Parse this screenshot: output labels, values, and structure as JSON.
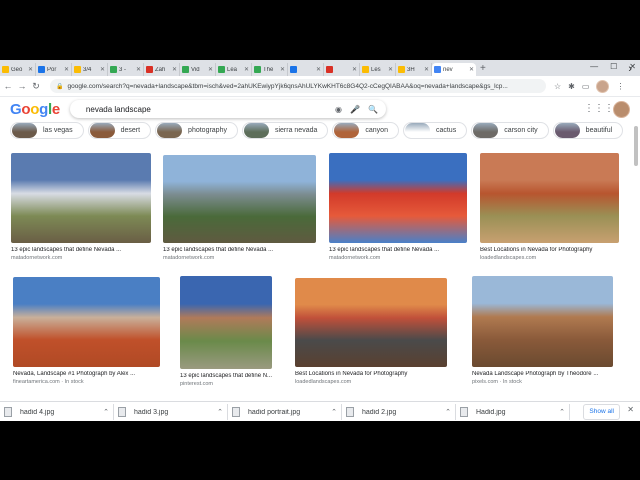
{
  "tabs": [
    {
      "label": "Geo",
      "color": "#fbbc04"
    },
    {
      "label": "Por",
      "color": "#1a73e8"
    },
    {
      "label": "3/4",
      "color": "#fbbc04"
    },
    {
      "label": "3 -",
      "color": "#34a853"
    },
    {
      "label": "Zah",
      "color": "#d93025"
    },
    {
      "label": "Vid",
      "color": "#34a853"
    },
    {
      "label": "Lea",
      "color": "#34a853"
    },
    {
      "label": "The",
      "color": "#34a853"
    },
    {
      "label": "",
      "color": "#1a73e8"
    },
    {
      "label": "",
      "color": "#d93025"
    },
    {
      "label": "Les",
      "color": "#fbbc04"
    },
    {
      "label": "3H",
      "color": "#fbbc04"
    }
  ],
  "active_tab": {
    "label": "nev",
    "color": "#4285f4"
  },
  "address": "google.com/search?q=nevada+landscape&tbm=isch&ved=2ahUKEwiypYjk6qnsAhULYKwKHT6c8G4Q2-cCegQIABAA&oq=nevada+landscape&gs_lcp...",
  "search": {
    "query": "nevada landscape"
  },
  "logo": "Google",
  "chips": [
    {
      "label": "las vegas",
      "color": "#6b5a4a"
    },
    {
      "label": "desert",
      "color": "#8a5a3a"
    },
    {
      "label": "photography",
      "color": "#7a6650"
    },
    {
      "label": "sierra nevada",
      "color": "#5d6e5a"
    },
    {
      "label": "canyon",
      "color": "#b0643a"
    },
    {
      "label": "cactus",
      "color": "#ffffff"
    },
    {
      "label": "carson city",
      "color": "#6d6a66"
    },
    {
      "label": "beautiful",
      "color": "#6a5a6e"
    }
  ],
  "results": [
    {
      "caption": "13 epic landscapes that define Nevada ...",
      "source": "matadornetwork.com",
      "colors": [
        "#5a7bb0",
        "#d8dce4",
        "#7d8a55",
        "#6a5e45"
      ]
    },
    {
      "caption": "13 epic landscapes that define Nevada ...",
      "source": "matadornetwork.com",
      "colors": [
        "#8fb3d9",
        "#7b8c8f",
        "#4a6a3a",
        "#5f5a40"
      ]
    },
    {
      "caption": "13 epic landscapes that define Nevada ...",
      "source": "matadornetwork.com",
      "colors": [
        "#3a6fc0",
        "#d23a2a",
        "#e65a3a",
        "#4a80c8"
      ]
    },
    {
      "caption": "Best Locations in Nevada for Photography",
      "source": "loadedlandscapes.com",
      "colors": [
        "#c97a55",
        "#b8552f",
        "#9a9055",
        "#c8a070"
      ]
    },
    {
      "caption": "Nevada, Landscape #1 Photograph by Alex ...",
      "source": "fineartamerica.com · In stock",
      "colors": [
        "#4a7fc4",
        "#c9b09a",
        "#c0502a",
        "#b04a25"
      ]
    },
    {
      "caption": "13 epic landscapes that define N...",
      "source": "pinterest.com",
      "colors": [
        "#3a66b0",
        "#b07a5a",
        "#6a8a4a",
        "#9a9a80"
      ]
    },
    {
      "caption": "Best Locations in Nevada for Photography",
      "source": "loadedlandscapes.com",
      "colors": [
        "#e08a4a",
        "#c0503a",
        "#4a4a4a",
        "#5a4030"
      ]
    },
    {
      "caption": "Nevada Landscape Photograph by Theodore ...",
      "source": "pixels.com · In stock",
      "colors": [
        "#9ab8d8",
        "#b07a50",
        "#8a5a3a",
        "#6a4a30"
      ]
    }
  ],
  "downloads": [
    {
      "name": "hadid 4.jpg"
    },
    {
      "name": "hadid 3.jpg"
    },
    {
      "name": "hadid portrait.jpg"
    },
    {
      "name": "hadid 2.jpg"
    },
    {
      "name": "Hadid.jpg"
    }
  ],
  "show_all": "Show all"
}
